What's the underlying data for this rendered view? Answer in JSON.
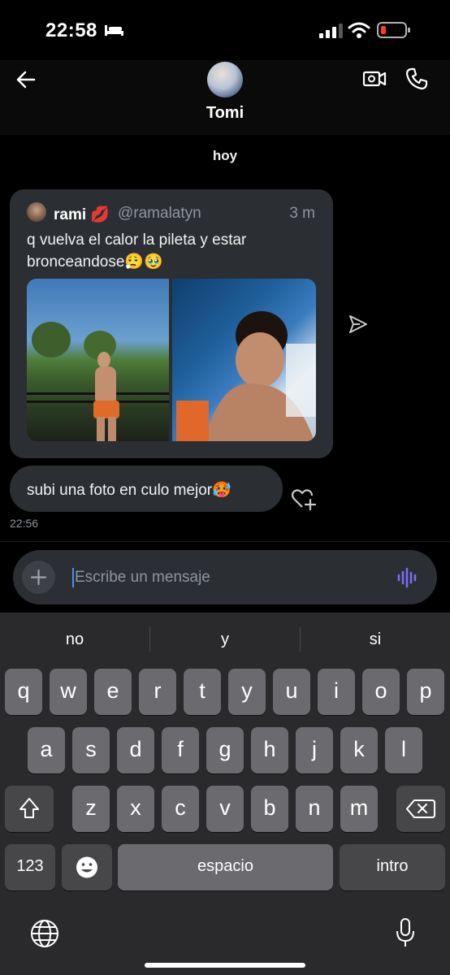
{
  "status_bar": {
    "time": "22:58"
  },
  "header": {
    "contact_name": "Tomi"
  },
  "chat": {
    "day_label": "hoy",
    "shared_post": {
      "author": "rami 💋",
      "handle": "@ramalatyn",
      "time": "3 m",
      "text": "q vuelva el calor la pileta y estar bronceandose😮‍💨🥹"
    },
    "message": {
      "text": "subi una foto en culo mejor🥵",
      "time": "22:56"
    }
  },
  "composer": {
    "placeholder": "Escribe un mensaje"
  },
  "keyboard": {
    "suggestions": [
      "no",
      "y",
      "si"
    ],
    "row1": [
      "q",
      "w",
      "e",
      "r",
      "t",
      "y",
      "u",
      "i",
      "o",
      "p"
    ],
    "row2": [
      "a",
      "s",
      "d",
      "f",
      "g",
      "h",
      "j",
      "k",
      "l"
    ],
    "row3": [
      "z",
      "x",
      "c",
      "v",
      "b",
      "n",
      "m"
    ],
    "numbers_label": "123",
    "space_label": "espacio",
    "return_label": "intro"
  },
  "colors": {
    "accent": "#4c8ff5",
    "bubble": "#2b2e33",
    "battery_low": "#ff3b30",
    "voice": "#7b6cf6"
  }
}
